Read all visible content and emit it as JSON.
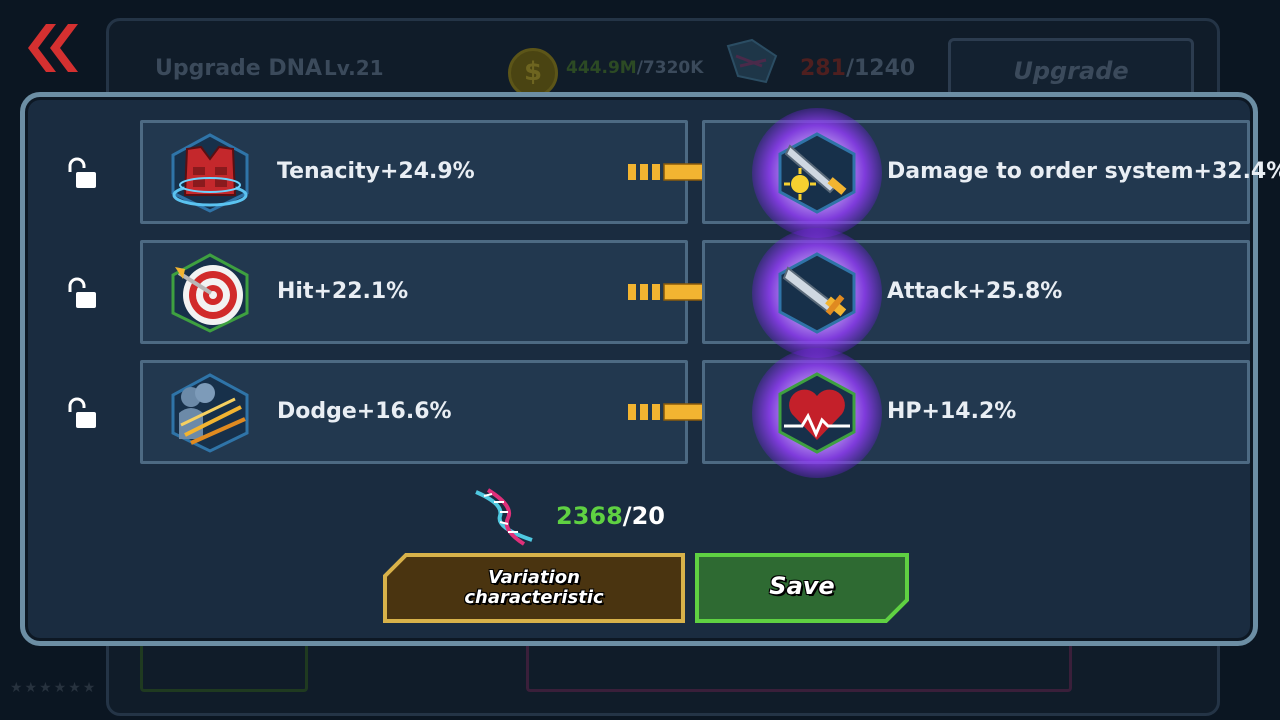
{
  "background": {
    "title": "Upgrade DNA",
    "level": "Lv.21",
    "gold_have": "444.9M",
    "gold_need": "/7320K",
    "material_have": "281",
    "material_need": "/1240",
    "upgrade_label": "Upgrade"
  },
  "rows": [
    {
      "current": "Tenacity+24.9%",
      "result": "Damage to order system+32.4%",
      "current_icon": "vest-icon",
      "result_icon": "sword-sun-icon"
    },
    {
      "current": "Hit+22.1%",
      "result": "Attack+25.8%",
      "current_icon": "target-icon",
      "result_icon": "sword-icon"
    },
    {
      "current": "Dodge+16.6%",
      "result": "HP+14.2%",
      "current_icon": "dodge-icon",
      "result_icon": "heart-icon"
    }
  ],
  "cost": {
    "have": "2368",
    "need": "/20"
  },
  "buttons": {
    "variation_line1": "Variation",
    "variation_line2": "characteristic",
    "save": "Save"
  },
  "colors": {
    "gold_arrow": "#f2b431",
    "save_green": "#2e6a32",
    "variation_brown": "#4a3410",
    "count_green": "#5fd142"
  }
}
